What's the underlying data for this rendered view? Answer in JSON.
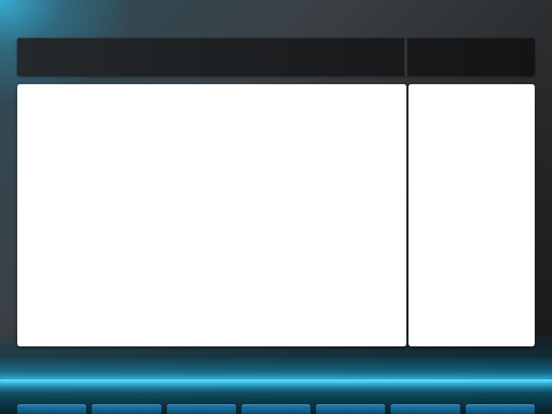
{
  "toolbar": {
    "title": "",
    "side_title": ""
  },
  "main_panel": {
    "content": ""
  },
  "side_panel": {
    "content": ""
  },
  "tabs": [
    {
      "label": ""
    },
    {
      "label": ""
    },
    {
      "label": ""
    },
    {
      "label": ""
    },
    {
      "label": ""
    },
    {
      "label": ""
    },
    {
      "label": ""
    }
  ],
  "colors": {
    "accent_glow": "#5fe0ff",
    "tab_blue": "#1f7fb3",
    "toolbar_dark": "#1c1e20",
    "panel_white": "#ffffff"
  }
}
